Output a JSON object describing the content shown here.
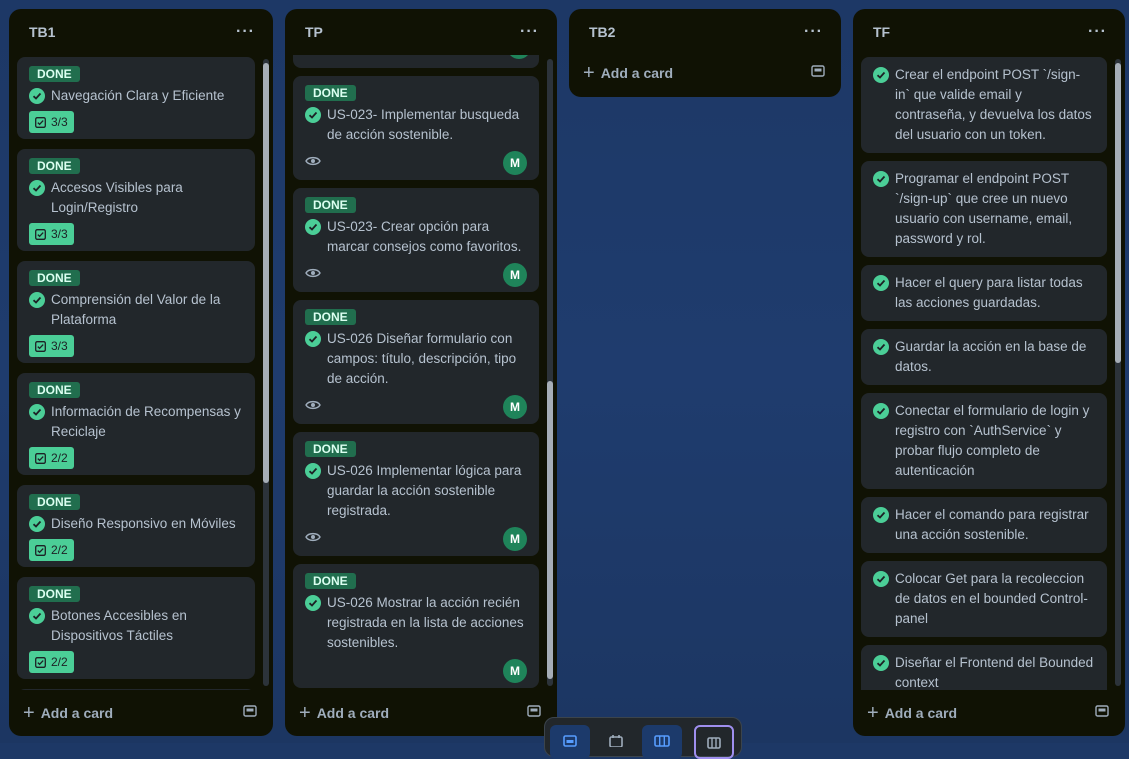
{
  "colors": {
    "board_background": "#1f3c6e",
    "list_background": "#101204",
    "card_background": "#22272b",
    "done_label": "#216e4e",
    "check_green": "#4bce97",
    "avatar_green": "#1f845a"
  },
  "lists": {
    "tb1": {
      "title": "TB1",
      "add_card": "Add a card",
      "cards": [
        {
          "label": "DONE",
          "text": "Navegación Clara y Eficiente",
          "checklist": "3/3"
        },
        {
          "label": "DONE",
          "text": "Accesos Visibles para Login/Registro",
          "checklist": "3/3"
        },
        {
          "label": "DONE",
          "text": "Comprensión del Valor de la Plataforma",
          "checklist": "3/3"
        },
        {
          "label": "DONE",
          "text": "Información de Recompensas y Reciclaje",
          "checklist": "2/2"
        },
        {
          "label": "DONE",
          "text": "Diseño Responsivo en Móviles",
          "checklist": "2/2"
        },
        {
          "label": "DONE",
          "text": "Botones Accesibles en Dispositivos Táctiles",
          "checklist": "2/2"
        }
      ]
    },
    "tp": {
      "title": "TP",
      "add_card": "Add a card",
      "cards": [
        {
          "label": "DONE",
          "text": "US-023- Implementar busqueda de acción sostenible.",
          "avatar": "M"
        },
        {
          "label": "DONE",
          "text": "US-023- Crear opción para marcar consejos como favoritos.",
          "avatar": "M"
        },
        {
          "label": "DONE",
          "text": "US-026 Diseñar formulario con campos: título, descripción, tipo de acción.",
          "avatar": "M"
        },
        {
          "label": "DONE",
          "text": "US-026 Implementar lógica para guardar la acción sostenible registrada.",
          "avatar": "M"
        },
        {
          "label": "DONE",
          "text": "US-026 Mostrar la acción recién registrada en la lista de acciones sostenibles.",
          "avatar": "M"
        }
      ]
    },
    "tb2": {
      "title": "TB2",
      "add_card": "Add a card"
    },
    "tf": {
      "title": "TF",
      "add_card": "Add a card",
      "cards": [
        {
          "text": "Crear el endpoint POST `/sign-in` que valide email y contraseña, y devuelva los datos del usuario con un token."
        },
        {
          "text": "Programar el endpoint POST `/sign-up` que cree un nuevo usuario con username, email, password y rol."
        },
        {
          "text": "Hacer el query para listar todas las acciones guardadas."
        },
        {
          "text": "Guardar la acción en la base de datos."
        },
        {
          "text": "Conectar el formulario de login y registro con `AuthService` y probar flujo completo de autenticación"
        },
        {
          "text": "Hacer el comando para registrar una acción sostenible."
        },
        {
          "text": "Colocar Get para la recoleccion de datos en el bounded Control-panel"
        },
        {
          "text": "Diseñar el Frontend del Bounded context"
        }
      ]
    }
  },
  "icons": {
    "more": "ellipsis-icon",
    "check": "check-circle-icon",
    "checklist": "checklist-icon",
    "watch": "eye-icon",
    "template": "card-template-icon",
    "add": "plus-icon"
  }
}
